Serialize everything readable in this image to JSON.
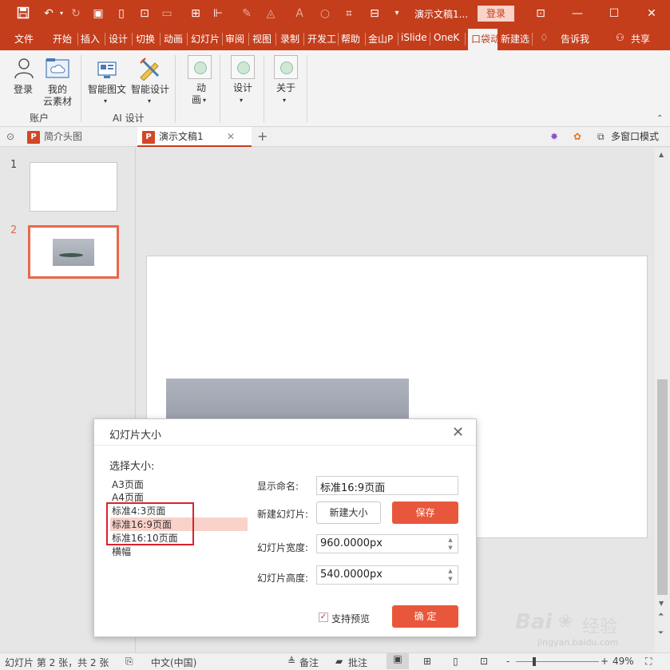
{
  "titlebar": {
    "doc_title": "演示文稿1...",
    "login": "登录",
    "icons": [
      "save-icon",
      "undo-icon",
      "redo-icon",
      "slideshow-icon",
      "new-icon",
      "preview-icon",
      "image-icon",
      "grid-icon",
      "layout-icon",
      "eyedropper-icon",
      "fill-icon",
      "font-color-icon",
      "shape-icon",
      "screenshot-icon",
      "more-icon"
    ]
  },
  "menu": [
    "文件",
    "开始",
    "插入",
    "设计",
    "切换",
    "动画",
    "幻灯片",
    "审阅",
    "视图",
    "录制",
    "开发工",
    "帮助",
    "金山P",
    "iSlide",
    "OneK",
    "口袋动",
    "新建选",
    "告诉我",
    "共享"
  ],
  "ribbon": {
    "login": "登录",
    "my_assets": [
      "我的",
      "云素材"
    ],
    "account_group": "账户",
    "smart_text": "智能图文",
    "smart_design": "智能设计",
    "ai_group": "AI 设计",
    "animation": [
      "动",
      "画"
    ],
    "design": "设计",
    "about": "关于"
  },
  "tabs": {
    "tab1": "简介头图",
    "tab2": "演示文稿1",
    "add": "+",
    "multi_window": "多窗口模式"
  },
  "thumbs": {
    "n1": "1",
    "n2": "2"
  },
  "dialog": {
    "title": "幻灯片大小",
    "select_label": "选择大小:",
    "sizes": [
      "A3页面",
      "A4页面",
      "标准4:3页面",
      "标准16:9页面",
      "标准16:10页面",
      "横幅"
    ],
    "display_name_label": "显示命名:",
    "display_name_value": "标准16:9页面",
    "new_slide_label": "新建幻灯片:",
    "new_size_btn": "新建大小",
    "save_btn": "保存",
    "width_label": "幻灯片宽度:",
    "width_value": "960.0000px",
    "height_label": "幻灯片高度:",
    "height_value": "540.0000px",
    "preview_label": "支持预览",
    "ok_btn": "确 定"
  },
  "status": {
    "slide_info": "幻灯片 第 2 张，共 2 张",
    "lang": "中文(中国)",
    "notes": "备注",
    "comments": "批注",
    "zoom": "49%",
    "minus": "-",
    "plus": "+"
  },
  "watermark": {
    "brand": "Bai",
    "brand2": "经验",
    "url": "jingyan.baidu.com"
  },
  "colors": {
    "accent": "#c43e1c",
    "button": "#e8573b",
    "highlight": "#f9d2c9",
    "annotation": "#d9232e"
  }
}
